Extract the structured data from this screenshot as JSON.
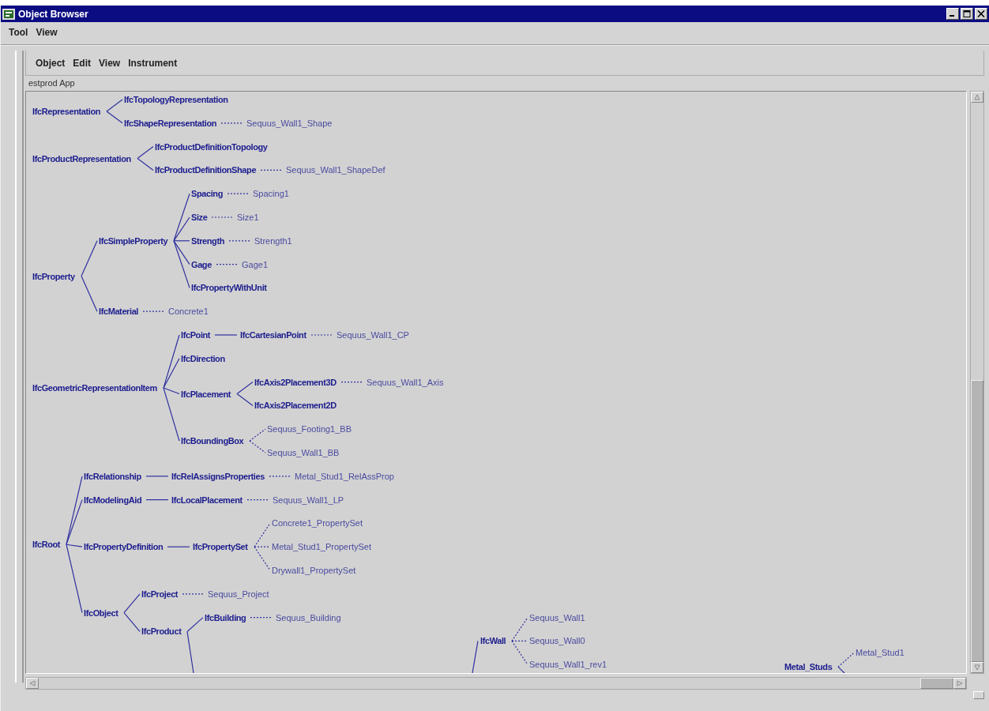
{
  "window": {
    "title": "Object Browser"
  },
  "menu": [
    {
      "label": "Tool"
    },
    {
      "label": "View"
    }
  ],
  "inner_menu": [
    {
      "label": "Object"
    },
    {
      "label": "Edit"
    },
    {
      "label": "View"
    },
    {
      "label": "Instrument"
    }
  ],
  "panel_label": "estprod App",
  "trees": [
    {
      "text": "IfcRepresentation",
      "kind": "class",
      "children": [
        {
          "text": "IfcTopologyRepresentation",
          "kind": "class"
        },
        {
          "text": "IfcShapeRepresentation",
          "kind": "class",
          "children": [
            {
              "text": "Sequus_Wall1_Shape",
              "kind": "instance"
            }
          ]
        }
      ]
    },
    {
      "text": "IfcProductRepresentation",
      "kind": "class",
      "children": [
        {
          "text": "IfcProductDefinitionTopology",
          "kind": "class"
        },
        {
          "text": "IfcProductDefinitionShape",
          "kind": "class",
          "children": [
            {
              "text": "Sequus_Wall1_ShapeDef",
              "kind": "instance"
            }
          ]
        }
      ]
    },
    {
      "text": "IfcProperty",
      "kind": "class",
      "children": [
        {
          "text": "IfcSimpleProperty",
          "kind": "class",
          "children": [
            {
              "text": "Spacing",
              "kind": "class",
              "children": [
                {
                  "text": "Spacing1",
                  "kind": "instance"
                }
              ]
            },
            {
              "text": "Size",
              "kind": "class",
              "children": [
                {
                  "text": "Size1",
                  "kind": "instance"
                }
              ]
            },
            {
              "text": "Strength",
              "kind": "class",
              "children": [
                {
                  "text": "Strength1",
                  "kind": "instance"
                }
              ]
            },
            {
              "text": "Gage",
              "kind": "class",
              "children": [
                {
                  "text": "Gage1",
                  "kind": "instance"
                }
              ]
            },
            {
              "text": "IfcPropertyWithUnit",
              "kind": "class"
            }
          ]
        },
        {
          "text": "IfcMaterial",
          "kind": "class",
          "children": [
            {
              "text": "Concrete1",
              "kind": "instance"
            }
          ]
        }
      ]
    },
    {
      "text": "IfcGeometricRepresentationItem",
      "kind": "class",
      "children": [
        {
          "text": "IfcPoint",
          "kind": "class",
          "children": [
            {
              "text": "IfcCartesianPoint",
              "kind": "class",
              "children": [
                {
                  "text": "Sequus_Wall1_CP",
                  "kind": "instance"
                }
              ]
            }
          ]
        },
        {
          "text": "IfcDirection",
          "kind": "class"
        },
        {
          "text": "IfcPlacement",
          "kind": "class",
          "children": [
            {
              "text": "IfcAxis2Placement3D",
              "kind": "class",
              "children": [
                {
                  "text": "Sequus_Wall1_Axis",
                  "kind": "instance"
                }
              ]
            },
            {
              "text": "IfcAxis2Placement2D",
              "kind": "class"
            }
          ]
        },
        {
          "text": "IfcBoundingBox",
          "kind": "class",
          "children": [
            {
              "text": "Sequus_Footing1_BB",
              "kind": "instance"
            },
            {
              "text": "Sequus_Wall1_BB",
              "kind": "instance"
            }
          ]
        }
      ]
    },
    {
      "text": "IfcRoot",
      "kind": "class",
      "children": [
        {
          "text": "IfcRelationship",
          "kind": "class",
          "children": [
            {
              "text": "IfcRelAssignsProperties",
              "kind": "class",
              "children": [
                {
                  "text": "Metal_Stud1_RelAssProp",
                  "kind": "instance"
                }
              ]
            }
          ]
        },
        {
          "text": "IfcModelingAid",
          "kind": "class",
          "children": [
            {
              "text": "IfcLocalPlacement",
              "kind": "class",
              "children": [
                {
                  "text": "Sequus_Wall1_LP",
                  "kind": "instance"
                }
              ]
            }
          ]
        },
        {
          "text": "IfcPropertyDefinition",
          "kind": "class",
          "children": [
            {
              "text": "IfcPropertySet",
              "kind": "class",
              "children": [
                {
                  "text": "Concrete1_PropertySet",
                  "kind": "instance"
                },
                {
                  "text": "Metal_Stud1_PropertySet",
                  "kind": "instance"
                },
                {
                  "text": "Drywall1_PropertySet",
                  "kind": "instance"
                }
              ]
            }
          ]
        },
        {
          "text": "IfcObject",
          "kind": "class",
          "children": [
            {
              "text": "IfcProject",
              "kind": "class",
              "children": [
                {
                  "text": "Sequus_Project",
                  "kind": "instance"
                }
              ]
            },
            {
              "text": "IfcProduct",
              "kind": "class",
              "continues_below": true,
              "children": [
                {
                  "text": "IfcBuilding",
                  "kind": "class",
                  "children": [
                    {
                      "text": "Sequus_Building",
                      "kind": "instance"
                    }
                  ]
                }
              ]
            }
          ]
        }
      ]
    }
  ],
  "fragments": [
    {
      "text": "IfcWall",
      "kind": "class",
      "parent_hidden": true,
      "children": [
        {
          "text": "Sequus_Wall1",
          "kind": "instance"
        },
        {
          "text": "Sequus_Wall0",
          "kind": "instance"
        },
        {
          "text": "Sequus_Wall1_rev1",
          "kind": "instance"
        }
      ]
    },
    {
      "text": "Metal_Studs",
      "kind": "class",
      "parent_hidden": false,
      "continues_below": true,
      "children": [
        {
          "text": "Metal_Stud1",
          "kind": "instance"
        }
      ]
    }
  ]
}
